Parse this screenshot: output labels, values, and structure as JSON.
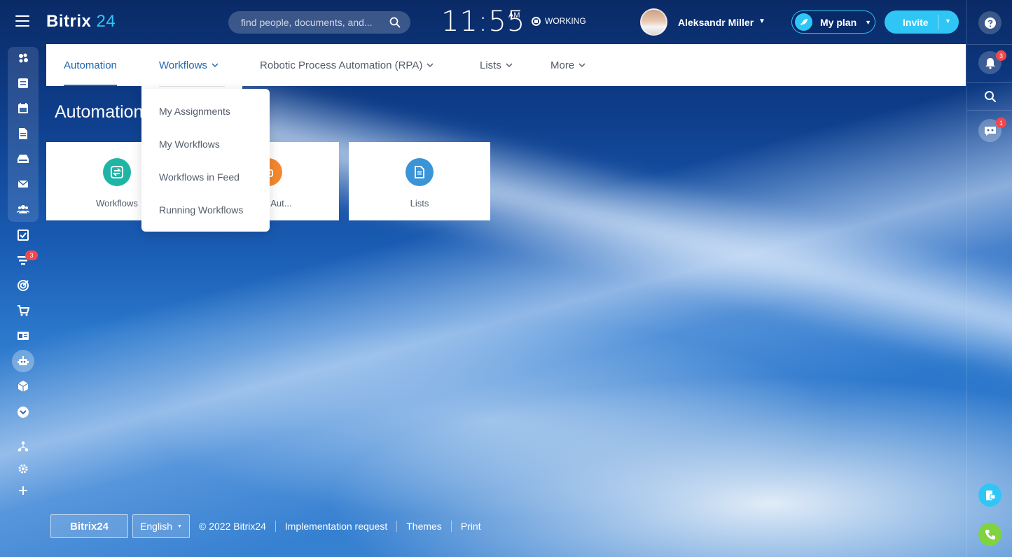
{
  "header": {
    "logo_text": "Bitrix",
    "logo_number": "24",
    "search_placeholder": "find people, documents, and...",
    "clock_time": "11:55",
    "clock_ampm": "AM",
    "work_status": "WORKING",
    "user_name": "Aleksandr Miller",
    "plan_label": "My plan",
    "invite_label": "Invite"
  },
  "left_sidebar": {
    "items": [
      {
        "icon": "feed-icon"
      },
      {
        "icon": "messenger-icon"
      },
      {
        "icon": "calendar-icon"
      },
      {
        "icon": "documents-icon"
      },
      {
        "icon": "drive-icon"
      },
      {
        "icon": "mail-icon"
      },
      {
        "icon": "workgroups-icon"
      },
      {
        "icon": "tasks-icon"
      },
      {
        "icon": "crm-icon",
        "badge": "3"
      },
      {
        "icon": "marketing-icon"
      },
      {
        "icon": "store-icon"
      },
      {
        "icon": "sites-icon"
      },
      {
        "icon": "automation-icon"
      },
      {
        "icon": "inventory-icon"
      },
      {
        "icon": "more-icon"
      },
      {
        "icon": "sitemap-icon"
      },
      {
        "icon": "settings-icon"
      },
      {
        "icon": "add-icon"
      }
    ]
  },
  "topnav": {
    "tabs": [
      {
        "label": "Automation"
      },
      {
        "label": "Workflows"
      },
      {
        "label": "Robotic Process Automation (RPA)"
      },
      {
        "label": "Lists"
      },
      {
        "label": "More"
      }
    ]
  },
  "dropdown": {
    "items": [
      {
        "label": "My Assignments"
      },
      {
        "label": "My Workflows"
      },
      {
        "label": "Workflows in Feed"
      },
      {
        "label": "Running Workflows"
      }
    ]
  },
  "page_title": "Automation",
  "cards": [
    {
      "label": "Workflows",
      "icon": "workflows-icon",
      "color": "#1fb5a5"
    },
    {
      "label": "ocess Aut...",
      "icon": "rpa-icon",
      "color": "#f5882e"
    },
    {
      "label": "Lists",
      "icon": "lists-icon",
      "color": "#3a94d6"
    }
  ],
  "right_sidebar": {
    "notifications_badge": "3",
    "chat_badge": "1"
  },
  "footer": {
    "logo": "Bitrix24",
    "language": "English",
    "copyright": "© 2022 Bitrix24",
    "implementation_request": "Implementation request",
    "themes": "Themes",
    "print": "Print"
  },
  "colors": {
    "accent": "#2067b0",
    "brand_cyan": "#2fc6f6",
    "badge_red": "#f5474b"
  }
}
